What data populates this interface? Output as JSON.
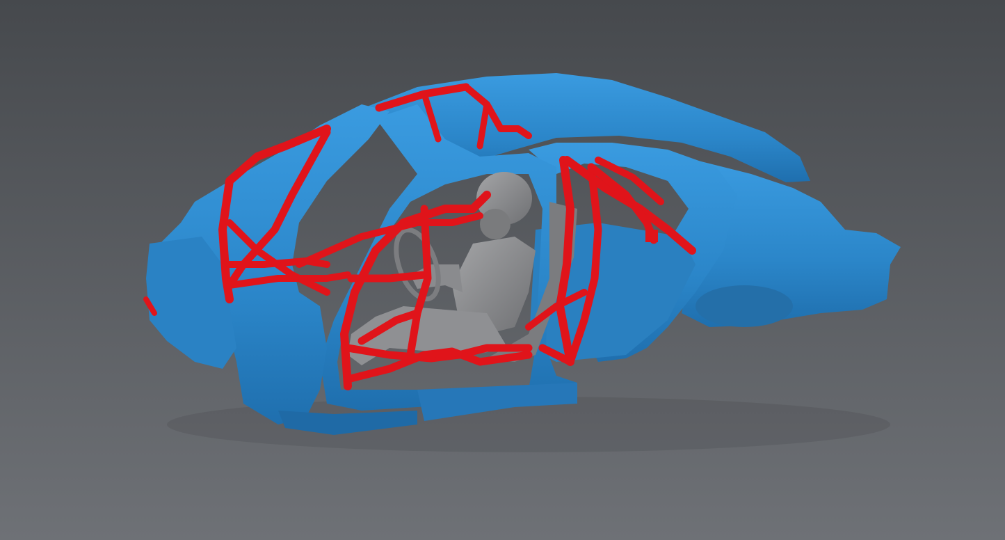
{
  "viewer": {
    "background_top": "#46494d",
    "background_bottom": "#6e7176"
  },
  "model": {
    "body_shell": {
      "part": "body-shell",
      "color": "#2b86c9"
    },
    "roll_cage": {
      "part": "roll-cage",
      "color": "#e0141a"
    },
    "driver": {
      "part": "driver-figure",
      "color": "#8c8d8f"
    }
  }
}
